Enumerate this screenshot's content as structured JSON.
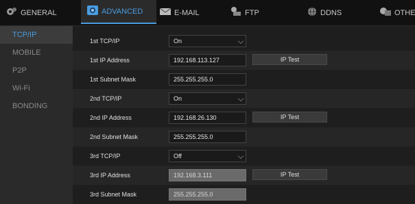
{
  "tabs": [
    {
      "id": "general",
      "label": "GENERAL",
      "icon": "gear-icon"
    },
    {
      "id": "advanced",
      "label": "ADVANCED",
      "icon": "settings-icon",
      "active": true
    },
    {
      "id": "email",
      "label": "E-MAIL",
      "icon": "mail-icon"
    },
    {
      "id": "ftp",
      "label": "FTP",
      "icon": "ftp-icon"
    },
    {
      "id": "ddns",
      "label": "DDNS",
      "icon": "globe-icon"
    },
    {
      "id": "other",
      "label": "OTHER",
      "icon": "other-icon"
    }
  ],
  "sidebar": {
    "items": [
      {
        "label": "TCP/IP",
        "active": true
      },
      {
        "label": "MOBILE"
      },
      {
        "label": "P2P"
      },
      {
        "label": "Wi-Fi"
      },
      {
        "label": "BONDING"
      }
    ]
  },
  "form": {
    "rows": [
      {
        "label": "1st TCP/IP",
        "value": "On",
        "type": "select"
      },
      {
        "label": "1st IP Address",
        "value": "192.168.113.127",
        "type": "input",
        "button": "IP Test"
      },
      {
        "label": "1st Subnet Mask",
        "value": "255.255.255.0",
        "type": "input"
      },
      {
        "label": "2nd TCP/IP",
        "value": "On",
        "type": "select"
      },
      {
        "label": "2nd IP Address",
        "value": "192.168.26.130",
        "type": "input",
        "button": "IP Test"
      },
      {
        "label": "2nd Subnet Mask",
        "value": "255.255.255.0",
        "type": "input"
      },
      {
        "label": "3rd TCP/IP",
        "value": "Off",
        "type": "select"
      },
      {
        "label": "3rd IP Address",
        "value": "192.168.3.111",
        "type": "input",
        "disabled": true,
        "button": "IP Test"
      },
      {
        "label": "3rd Subnet Mask",
        "value": "255.255.255.0",
        "type": "input",
        "disabled": true
      }
    ]
  },
  "colors": {
    "accent": "#4a9de0",
    "background": "#1e1e1e",
    "sidebar": "#2a2a2a"
  }
}
